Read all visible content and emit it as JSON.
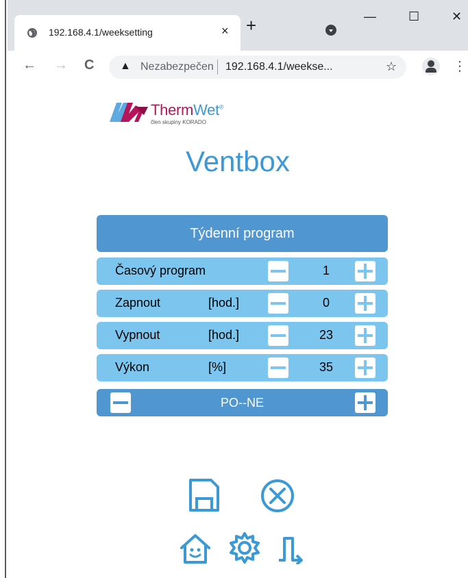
{
  "browser": {
    "tab_title": "192.168.4.1/weeksetting",
    "tab_close": "×",
    "new_tab": "+",
    "minimize": "—",
    "maximize": "☐",
    "close": "✕",
    "back": "←",
    "forward": "→",
    "reload": "C",
    "warning_icon": "▲",
    "security_label": "Nezabezpečen",
    "url": "192.168.4.1/weekse...",
    "bookmark": "☆",
    "menu": "⋮"
  },
  "logo": {
    "brand_a": "Therm",
    "brand_b": "Wet",
    "reg": "®",
    "tagline": "člen skupiny KORADO"
  },
  "app_title": "Ventbox",
  "panel": {
    "header": "Týdenní program",
    "rows": [
      {
        "label": "Časový program",
        "unit": "",
        "value": "1"
      },
      {
        "label": "Zapnout",
        "unit": "[hod.]",
        "value": "0"
      },
      {
        "label": "Vypnout",
        "unit": "[hod.]",
        "value": "23"
      },
      {
        "label": "Výkon",
        "unit": "[%]",
        "value": "35"
      }
    ],
    "day": "PO--NE"
  },
  "colors": {
    "accent": "#3b9ad6",
    "header_blue": "#5096d0",
    "row_blue": "#7cc5ef",
    "brand_magenta": "#b5165b"
  },
  "icons": [
    "save-icon",
    "cancel-icon",
    "home-icon",
    "settings-icon",
    "program-icon"
  ]
}
